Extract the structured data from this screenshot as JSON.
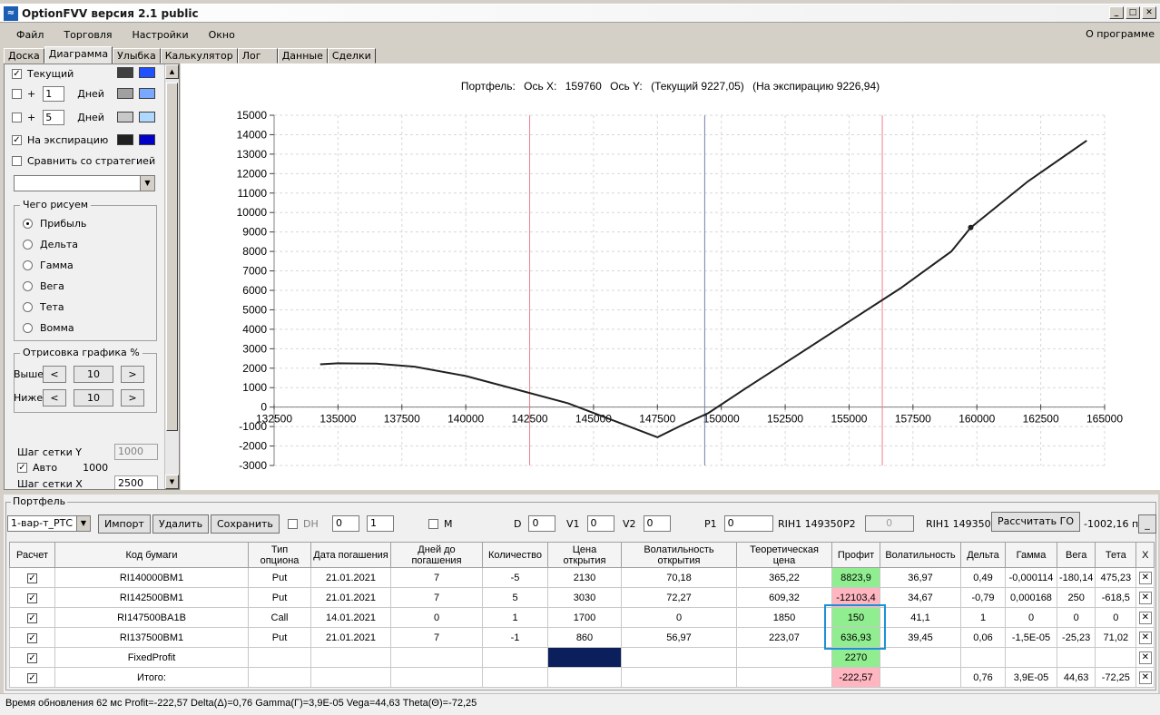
{
  "window": {
    "title": "OptionFVV версия 2.1 public"
  },
  "menu": {
    "items": [
      "Файл",
      "Торговля",
      "Настройки",
      "Окно"
    ],
    "about": "О программе"
  },
  "tabs": [
    "Доска",
    "Диаграмма",
    "Улыбка",
    "Калькулятор",
    "Лог",
    "Данные",
    "Сделки"
  ],
  "left": {
    "current_label": "Текущий",
    "plus_label": "+",
    "days_label": "Дней",
    "days1": "1",
    "days2": "5",
    "expiry_label": "На экспирацию",
    "compare_label": "Сравнить со стратегией",
    "draw_group": "Чего рисуем",
    "radios": [
      "Прибыль",
      "Дельта",
      "Гамма",
      "Вега",
      "Тета",
      "Вомма"
    ],
    "render_group": "Отрисовка графика %",
    "above_label": "Выше",
    "below_label": "Ниже",
    "above_val": "10",
    "below_val": "10",
    "grid_y_label": "Шаг сетки Y",
    "grid_y_val": "1000",
    "auto_label": "Авто",
    "auto_val": "1000",
    "grid_x_label": "Шаг сетки X",
    "grid_x_val": "2500",
    "colors": {
      "current_dark": "#404040",
      "current_light": "#1e50ff",
      "d1_dark": "#a0a0a0",
      "d1_light": "#78a8ff",
      "d2_dark": "#c8c8c8",
      "d2_light": "#b0d8ff",
      "exp_dark": "#202020",
      "exp_light": "#0000c8"
    }
  },
  "chart": {
    "title_parts": [
      "Портфель:",
      "Ось X:",
      "159760",
      "Ось Y:",
      "(Текущий 9227,05)",
      "(На экспирацию 9226,94)"
    ]
  },
  "chart_data": {
    "type": "line",
    "xlim": [
      132500,
      165000
    ],
    "ylim": [
      -3000,
      15000
    ],
    "x_ticks": [
      132500,
      135000,
      137500,
      140000,
      142500,
      145000,
      147500,
      150000,
      152500,
      155000,
      157500,
      160000,
      162500,
      165000
    ],
    "y_ticks": [
      -3000,
      -2000,
      -1000,
      0,
      1000,
      2000,
      3000,
      4000,
      5000,
      6000,
      7000,
      8000,
      9000,
      10000,
      11000,
      12000,
      13000,
      14000,
      15000
    ],
    "grid": true,
    "series": [
      {
        "points": [
          [
            134300,
            2200
          ],
          [
            135000,
            2250
          ],
          [
            136500,
            2230
          ],
          [
            138000,
            2080
          ],
          [
            140000,
            1600
          ],
          [
            142000,
            900
          ],
          [
            144000,
            200
          ],
          [
            146000,
            -800
          ],
          [
            147500,
            -1550
          ],
          [
            148500,
            -900
          ],
          [
            149500,
            -300
          ],
          [
            151000,
            1000
          ],
          [
            153000,
            2700
          ],
          [
            155000,
            4400
          ],
          [
            157000,
            6100
          ],
          [
            159000,
            8000
          ],
          [
            159760,
            9227
          ],
          [
            162000,
            11600
          ],
          [
            164300,
            13700
          ]
        ]
      }
    ],
    "marker": {
      "x": 159760,
      "y": 9227
    },
    "vlines": [
      {
        "x": 142500,
        "color": "#f08090"
      },
      {
        "x": 149350,
        "color": "#7080b0"
      },
      {
        "x": 156300,
        "color": "#f08090"
      }
    ]
  },
  "portfolio": {
    "title": "Портфель",
    "portfolio_select": "1-вар-т_РТС",
    "import_btn": "Импорт",
    "delete_btn": "Удалить",
    "save_btn": "Сохранить",
    "dh_label": "DH",
    "dh_val1": "0",
    "dh_val2": "1",
    "m_label": "M",
    "d_label": "D",
    "d_val": "0",
    "v1_label": "V1",
    "v1_val": "0",
    "v2_label": "V2",
    "v2_val": "0",
    "p1_label": "P1",
    "p1_val": "0",
    "rih1_a": "RIH1 149350",
    "p2_label": "P2",
    "p2_val": "0",
    "rih1_b": "RIH1 149350",
    "calc_btn": "Рассчитать ГО",
    "go_val": "-1002,16 п.",
    "headers": [
      "Расчет",
      "Код бумаги",
      "Тип опциона",
      "Дата погашения",
      "Дней до погашения",
      "Количество",
      "Цена открытия",
      "Волатильность открытия",
      "Теоретическая цена",
      "Профит",
      "Волатильность",
      "Дельта",
      "Гамма",
      "Вега",
      "Тета",
      "X"
    ],
    "rows": [
      {
        "code": "RI140000BM1",
        "type": "Put",
        "date": "21.01.2021",
        "days": "7",
        "qty": "-5",
        "price": "2130",
        "vol_open": "70,18",
        "theo": "365,22",
        "profit": "8823,9",
        "vol": "36,97",
        "delta": "0,49",
        "gamma": "-0,000114",
        "vega": "-180,14",
        "theta": "475,23"
      },
      {
        "code": "RI142500BM1",
        "type": "Put",
        "date": "21.01.2021",
        "days": "7",
        "qty": "5",
        "price": "3030",
        "vol_open": "72,27",
        "theo": "609,32",
        "profit": "-12103,4",
        "vol": "34,67",
        "delta": "-0,79",
        "gamma": "0,000168",
        "vega": "250",
        "theta": "-618,5"
      },
      {
        "code": "RI147500BA1B",
        "type": "Call",
        "date": "14.01.2021",
        "days": "0",
        "qty": "1",
        "price": "1700",
        "vol_open": "0",
        "theo": "1850",
        "profit": "150",
        "vol": "41,1",
        "delta": "1",
        "gamma": "0",
        "vega": "0",
        "theta": "0"
      },
      {
        "code": "RI137500BM1",
        "type": "Put",
        "date": "21.01.2021",
        "days": "7",
        "qty": "-1",
        "price": "860",
        "vol_open": "56,97",
        "theo": "223,07",
        "profit": "636,93",
        "vol": "39,45",
        "delta": "0,06",
        "gamma": "-1,5E-05",
        "vega": "-25,23",
        "theta": "71,02"
      }
    ],
    "fixed": {
      "code": "FixedProfit",
      "profit": "2270"
    },
    "total": {
      "code": "Итого:",
      "profit": "-222,57",
      "delta": "0,76",
      "gamma": "3,9E-05",
      "vega": "44,63",
      "theta": "-72,25"
    }
  },
  "status": {
    "text": "Время обновления 62 мс  Profit=-222,57 Delta(Δ)=0,76 Gamma(Γ)=3,9E-05 Vega=44,63 Theta(Θ)=-72,25"
  }
}
